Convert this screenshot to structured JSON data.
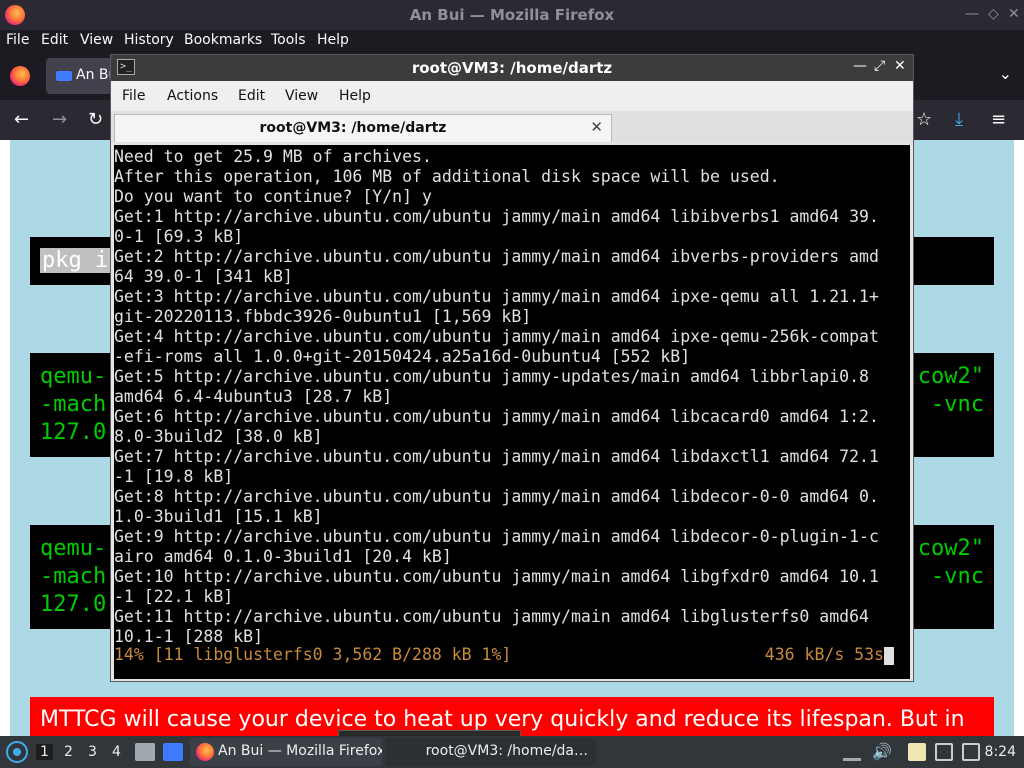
{
  "firefox": {
    "window_title": "An Bui — Mozilla Firefox",
    "menu": [
      "File",
      "Edit",
      "View",
      "History",
      "Bookmarks",
      "Tools",
      "Help"
    ],
    "tab_label": "An Bui",
    "icons": [
      "firefox-logo-icon",
      "back-icon",
      "forward-icon",
      "reload-icon",
      "bookmark-star-icon",
      "downloads-icon",
      "hamburger-menu-icon"
    ],
    "page": {
      "pkg_text": "pkg ins",
      "block1": {
        "lines": [
          "qemu-",
          "-mach",
          "127.0."
        ],
        "right": [
          "cow2\"",
          "-vnc"
        ]
      },
      "block2": {
        "lines": [
          "qemu-",
          "-mach",
          "127.0."
        ],
        "right": [
          "cow2\"",
          "-vnc"
        ]
      },
      "warning": "MTTCG will cause your device to heat up very quickly and reduce its lifespan. But in"
    },
    "colors": {
      "page_bg": "#add8e6",
      "code_bg": "#000000",
      "code_fg": "#00cc00",
      "warning_bg": "#ff0000"
    }
  },
  "terminal": {
    "window_title": "root@VM3: /home/dartz",
    "menu": [
      "File",
      "Actions",
      "Edit",
      "View",
      "Help"
    ],
    "tab_label": "root@VM3: /home/dartz",
    "lines": [
      "Need to get 25.9 MB of archives.",
      "After this operation, 106 MB of additional disk space will be used.",
      "Do you want to continue? [Y/n] y",
      "Get:1 http://archive.ubuntu.com/ubuntu jammy/main amd64 libibverbs1 amd64 39.",
      "0-1 [69.3 kB]",
      "Get:2 http://archive.ubuntu.com/ubuntu jammy/main amd64 ibverbs-providers amd",
      "64 39.0-1 [341 kB]",
      "Get:3 http://archive.ubuntu.com/ubuntu jammy/main amd64 ipxe-qemu all 1.21.1+",
      "git-20220113.fbbdc3926-0ubuntu1 [1,569 kB]",
      "Get:4 http://archive.ubuntu.com/ubuntu jammy/main amd64 ipxe-qemu-256k-compat",
      "-efi-roms all 1.0.0+git-20150424.a25a16d-0ubuntu4 [552 kB]",
      "Get:5 http://archive.ubuntu.com/ubuntu jammy-updates/main amd64 libbrlapi0.8",
      "amd64 6.4-4ubuntu3 [28.7 kB]",
      "Get:6 http://archive.ubuntu.com/ubuntu jammy/main amd64 libcacard0 amd64 1:2.",
      "8.0-3build2 [38.0 kB]",
      "Get:7 http://archive.ubuntu.com/ubuntu jammy/main amd64 libdaxctl1 amd64 72.1",
      "-1 [19.8 kB]",
      "Get:8 http://archive.ubuntu.com/ubuntu jammy/main amd64 libdecor-0-0 amd64 0.",
      "1.0-3build1 [15.1 kB]",
      "Get:9 http://archive.ubuntu.com/ubuntu jammy/main amd64 libdecor-0-plugin-1-c",
      "airo amd64 0.1.0-3build1 [20.4 kB]",
      "Get:10 http://archive.ubuntu.com/ubuntu jammy/main amd64 libgfxdr0 amd64 10.1",
      "-1 [22.1 kB]",
      "Get:11 http://archive.ubuntu.com/ubuntu jammy/main amd64 libglusterfs0 amd64",
      "10.1-1 [288 kB]"
    ],
    "status_left": "14% [11 libglusterfs0 3,562 B/288 kB 1%]",
    "status_right": "436 kB/s 53s",
    "colors": {
      "bg": "#000000",
      "fg": "#e0e0e0",
      "status": "#c98a3b"
    }
  },
  "tooltip": "An Bui — Mozilla Firefox",
  "taskbar": {
    "workspaces": [
      "1",
      "2",
      "3",
      "4"
    ],
    "tasks": [
      {
        "label": "An Bui — Mozilla Firefox",
        "icon": "firefox-icon"
      },
      {
        "label": "root@VM3: /home/da…",
        "icon": "terminal-icon"
      }
    ],
    "clock": "8:24",
    "tray_icons": [
      "eject-icon",
      "volume-icon",
      "clipboard-icon",
      "network-icon",
      "notifications-icon"
    ]
  }
}
